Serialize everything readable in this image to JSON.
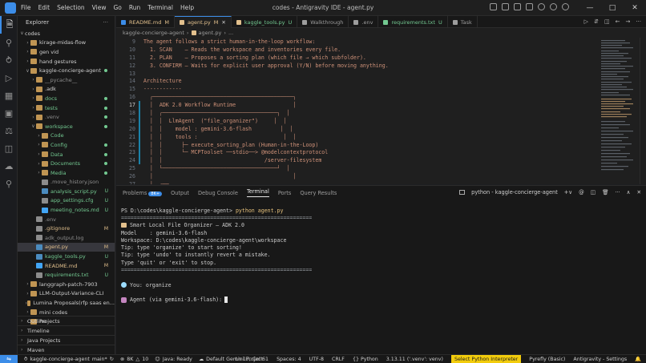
{
  "window": {
    "title": "codes - Antigravity IDE - agent.py",
    "menu": [
      "File",
      "Edit",
      "Selection",
      "View",
      "Go",
      "Run",
      "Terminal",
      "Help"
    ]
  },
  "sidebar": {
    "header": "Explorer",
    "root": "codes",
    "items": [
      {
        "label": "kirage-midas-flow",
        "kind": "folder",
        "indent": 1,
        "open": false,
        "status": "",
        "color": "#cfcfcf"
      },
      {
        "label": "gen vid",
        "kind": "folder",
        "indent": 1,
        "open": false,
        "status": "",
        "color": "#cfcfcf"
      },
      {
        "label": "hand gestures",
        "kind": "folder",
        "indent": 1,
        "open": false,
        "status": "",
        "color": "#cfcfcf"
      },
      {
        "label": "kaggle-concierge-agent",
        "kind": "folder",
        "indent": 1,
        "open": true,
        "status": "dot",
        "color": "#cfcfcf"
      },
      {
        "label": "__pycache__",
        "kind": "folder",
        "indent": 2,
        "open": false,
        "status": "",
        "color": "#8c8c8c"
      },
      {
        "label": ".adk",
        "kind": "folder",
        "indent": 2,
        "open": false,
        "status": "",
        "color": "#cfcfcf"
      },
      {
        "label": "docs",
        "kind": "folder",
        "indent": 2,
        "open": false,
        "status": "dot",
        "color": "#73c991"
      },
      {
        "label": "tests",
        "kind": "folder",
        "indent": 2,
        "open": false,
        "status": "dot",
        "color": "#73c991"
      },
      {
        "label": ".venv",
        "kind": "folder",
        "indent": 2,
        "open": false,
        "status": "dot",
        "color": "#8c8c8c"
      },
      {
        "label": "workspace",
        "kind": "folder",
        "indent": 2,
        "open": true,
        "status": "dot",
        "color": "#73c991"
      },
      {
        "label": "Code",
        "kind": "folder",
        "indent": 3,
        "open": false,
        "status": "",
        "color": "#73c991"
      },
      {
        "label": "Config",
        "kind": "folder",
        "indent": 3,
        "open": false,
        "status": "dot",
        "color": "#73c991"
      },
      {
        "label": "Data",
        "kind": "folder",
        "indent": 3,
        "open": false,
        "status": "dot",
        "color": "#73c991"
      },
      {
        "label": "Documents",
        "kind": "folder",
        "indent": 3,
        "open": false,
        "status": "dot",
        "color": "#73c991"
      },
      {
        "label": "Media",
        "kind": "folder",
        "indent": 3,
        "open": false,
        "status": "dot",
        "color": "#73c991"
      },
      {
        "label": ".move_history.json",
        "kind": "file",
        "indent": 3,
        "open": false,
        "status": "",
        "color": "#8c8c8c"
      },
      {
        "label": "analysis_script.py",
        "kind": "file",
        "indent": 3,
        "open": false,
        "status": "U",
        "color": "#73c991"
      },
      {
        "label": "app_settings.cfg",
        "kind": "file",
        "indent": 3,
        "open": false,
        "status": "U",
        "color": "#73c991"
      },
      {
        "label": "meeting_notes.md",
        "kind": "file",
        "indent": 3,
        "open": false,
        "status": "U",
        "color": "#73c991"
      },
      {
        "label": ".env",
        "kind": "file",
        "indent": 2,
        "open": false,
        "status": "",
        "color": "#8c8c8c"
      },
      {
        "label": ".gitignore",
        "kind": "file",
        "indent": 2,
        "open": false,
        "status": "M",
        "color": "#e2c08d"
      },
      {
        "label": "adk_output.log",
        "kind": "file",
        "indent": 2,
        "open": false,
        "status": "",
        "color": "#8c8c8c"
      },
      {
        "label": "agent.py",
        "kind": "file",
        "indent": 2,
        "open": false,
        "status": "M",
        "color": "#e2c08d",
        "selected": true
      },
      {
        "label": "kaggle_tools.py",
        "kind": "file",
        "indent": 2,
        "open": false,
        "status": "U",
        "color": "#73c991"
      },
      {
        "label": "README.md",
        "kind": "file",
        "indent": 2,
        "open": false,
        "status": "M",
        "color": "#e2c08d"
      },
      {
        "label": "requirements.txt",
        "kind": "file",
        "indent": 2,
        "open": false,
        "status": "U",
        "color": "#73c991"
      },
      {
        "label": "langgraph-patch-7903",
        "kind": "folder",
        "indent": 1,
        "open": false,
        "status": "",
        "color": "#cfcfcf"
      },
      {
        "label": "LLM-Output-Variance-CLI",
        "kind": "folder",
        "indent": 1,
        "open": false,
        "status": "",
        "color": "#cfcfcf"
      },
      {
        "label": "Lumina Proposals(rfp saas en...",
        "kind": "folder",
        "indent": 1,
        "open": false,
        "status": "",
        "color": "#cfcfcf"
      },
      {
        "label": "mini codes",
        "kind": "folder",
        "indent": 1,
        "open": false,
        "status": "",
        "color": "#cfcfcf"
      },
      {
        "label": "Projects",
        "kind": "folder",
        "indent": 1,
        "open": false,
        "status": "",
        "color": "#cfcfcf"
      }
    ],
    "sections": [
      "Outline",
      "Timeline",
      "Java Projects",
      "Maven"
    ]
  },
  "tabs": [
    {
      "label": "README.md",
      "status": "M",
      "active": false,
      "color": "#3c8de8"
    },
    {
      "label": "agent.py",
      "status": "M",
      "active": true,
      "color": "#e2c08d"
    },
    {
      "label": "kaggle_tools.py",
      "status": "U",
      "active": false,
      "color": "#e2c08d"
    },
    {
      "label": "Walkthrough",
      "status": "",
      "active": false,
      "color": "#9d9d9d"
    },
    {
      "label": ".env",
      "status": "",
      "active": false,
      "color": "#9d9d9d"
    },
    {
      "label": "requirements.txt",
      "status": "U",
      "active": false,
      "color": "#73c991"
    },
    {
      "label": "Task",
      "status": "",
      "active": false,
      "color": "#9d9d9d"
    }
  ],
  "breadcrumb": [
    "kaggle-concierge-agent",
    "agent.py",
    "..."
  ],
  "editor": {
    "current_line": 17,
    "lines": [
      {
        "n": 9,
        "text": "The agent follows a strict human-in-the-loop workflow:"
      },
      {
        "n": 10,
        "text": "  1. SCAN    — Reads the workspace and inventories every file."
      },
      {
        "n": 11,
        "text": "  2. PLAN    — Proposes a sorting plan (which file → which subfolder)."
      },
      {
        "n": 12,
        "text": "  3. CONFIRM — Waits for explicit user approval (Y/N) before moving anything."
      },
      {
        "n": 13,
        "text": ""
      },
      {
        "n": 14,
        "text": "Architecture"
      },
      {
        "n": 15,
        "text": "------------"
      },
      {
        "n": 16,
        "text": "  ┌────────────────────────────────────────────┐"
      },
      {
        "n": 17,
        "text": "  │  ADK 2.0 Workflow Runtime                  │"
      },
      {
        "n": 18,
        "text": "  │  ┌────────────────────────────────────┐  │"
      },
      {
        "n": 19,
        "text": "  │  │  LlmAgent  (\"file_organizer\")     │  │"
      },
      {
        "n": 20,
        "text": "  │  │    model : gemini-3.6-flash         │  │"
      },
      {
        "n": 21,
        "text": "  │  │    tools :                           │  │"
      },
      {
        "n": 22,
        "text": "  │  │      ├─ execute_sorting_plan (Human-in-the-Loop)"
      },
      {
        "n": 23,
        "text": "  │  │      └─ MCPToolset ──stdio──> @modelcontextprotocol"
      },
      {
        "n": 24,
        "text": "  │  │                                /server-filesystem"
      },
      {
        "n": 25,
        "text": "  │  └────────────────────────────────────┘  │"
      },
      {
        "n": 26,
        "text": "  │                                            │"
      },
      {
        "n": 27,
        "text": "  │  ┌──"
      }
    ]
  },
  "panel": {
    "tabs": [
      "Problems",
      "Output",
      "Debug Console",
      "Terminal",
      "Ports",
      "Query Results"
    ],
    "problems_badge": "8K+",
    "active_tab": "Terminal",
    "terminal_name": "python - kaggle-concierge-agent",
    "terminal": {
      "prompt": "PS D:\\codes\\kaggle-concierge-agent>",
      "command": "python agent.py",
      "rule": "============================================================",
      "banner_title": "Smart Local File Organizer — ADK 2.0",
      "model_line": "Model    : gemini-3.6-flash",
      "workspace_line": "Workspace: D:\\codes\\kaggle-concierge-agent\\workspace",
      "tip1": "Tip: type 'organize' to start sorting!",
      "tip2": "Tip: type 'undo' to instantly revert a mistake.",
      "tip3": "Type 'quit' or 'exit' to stop.",
      "user_line": "You: organize",
      "agent_line": "Agent (via gemini-3.6-flash):"
    }
  },
  "statusbar": {
    "branch": "kaggle-concierge-agent",
    "branch_suffix": "main*",
    "problems": "8K",
    "warnings": "10",
    "java": "Java: Ready",
    "project": "Default Gemini Project",
    "position": "Ln 17, Col 61",
    "spaces": "Spaces: 4",
    "encoding": "UTF-8",
    "eol": "CRLF",
    "language": "Python",
    "interpreter": "3.13.11 ('.venv': venv)",
    "select_interpreter": "Select Python Interpreter",
    "pyrefly": "Pyrefly (Basic)",
    "settings": "Antigravity - Settings"
  }
}
